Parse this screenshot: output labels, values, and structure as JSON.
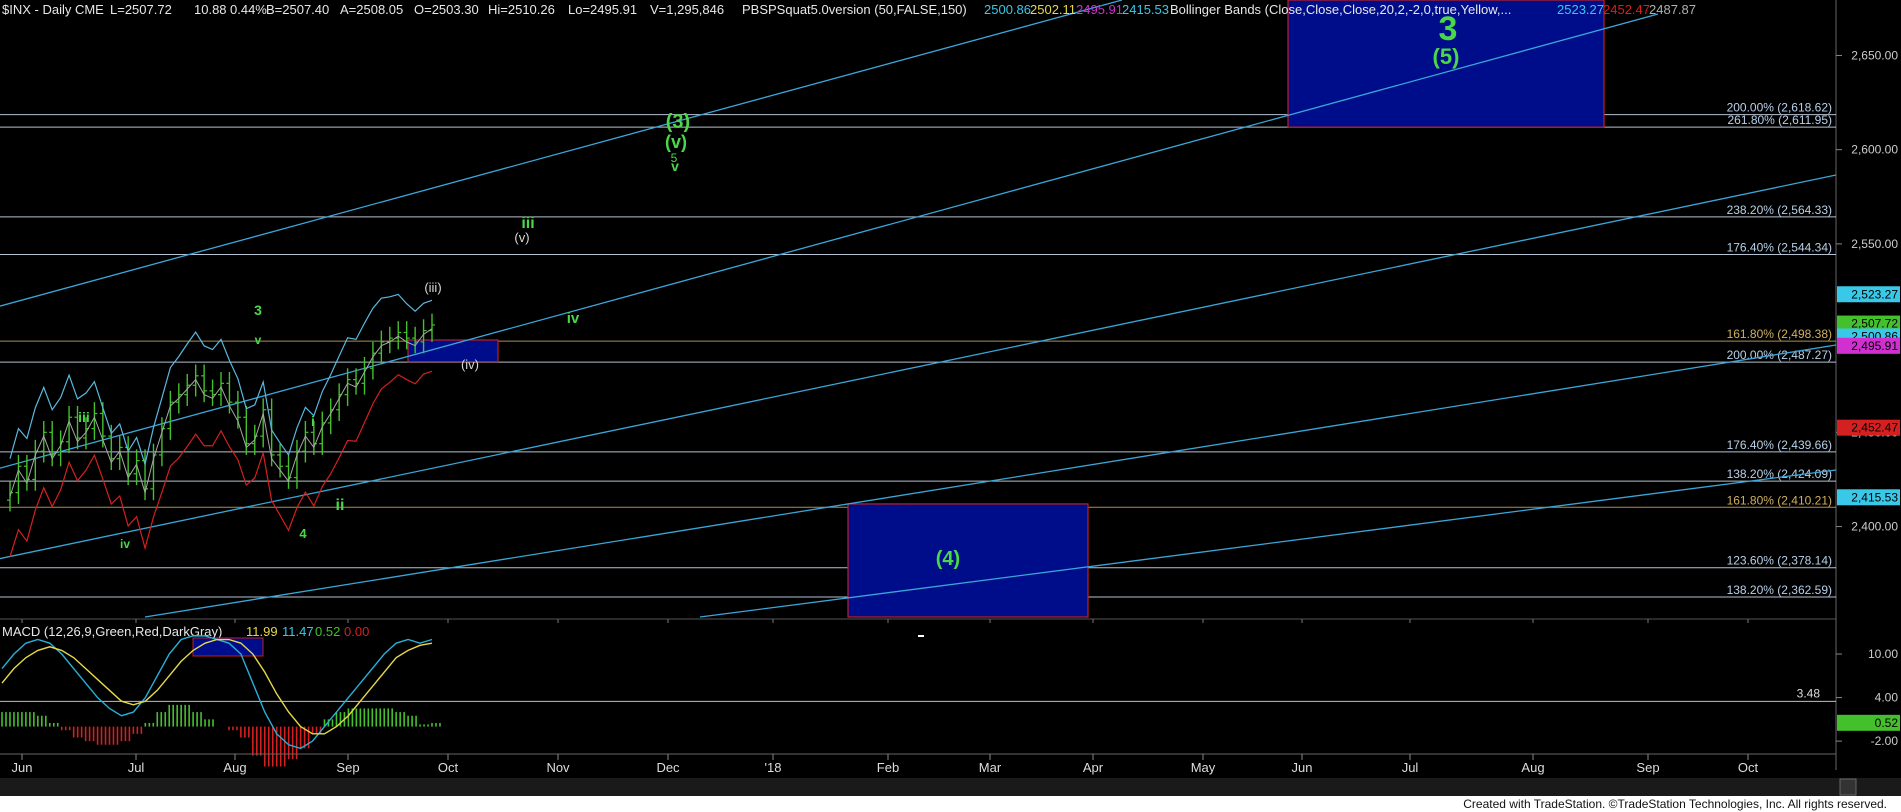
{
  "header": {
    "symbol": "$INX - Daily CME",
    "last": "L=2507.72",
    "chg": "10.88",
    "pct": "0.44%",
    "bid": "B=2507.40",
    "ask": "A=2508.05",
    "open": "O=2503.30",
    "hi": "Hi=2510.26",
    "lo": "Lo=2495.91",
    "vol": "V=1,295,846",
    "study": "PBSPSquat5.0version (50,FALSE,150)",
    "s1": "2500.86",
    "s2": "2502.11",
    "s3": "2495.91",
    "s4": "2415.53",
    "bb": "Bollinger Bands (Close,Close,Close,20,2,-2,0,true,Yellow,...",
    "b1": "2523.27",
    "b2": "2452.47",
    "b3": "2487.87"
  },
  "colors": {
    "background": "#000000",
    "grid": "#2a2a2a",
    "price_bar": "#44c02c",
    "channel": "#3aa6d8",
    "fib_line": "#c8d8e8",
    "fib_gold": "#b8a060",
    "box_fill": "#000d8a",
    "box_border": "#c02020",
    "wave_green": "#4ad84a",
    "macd_line": "#28b0d8",
    "macd_signal": "#e6d84a",
    "bb_upper": "#5ab8e0",
    "bb_lower": "#d42020",
    "bb_mid": "#a8a8a8"
  },
  "chart_data": [
    {
      "type": "candlestick",
      "title": "$INX - Daily CME",
      "ylim": [
        2352,
        2672
      ],
      "yticks": [
        "2,650.00",
        "2,600.00",
        "2,550.00",
        "2,450.00",
        "2,400.00"
      ],
      "x_labels": [
        "Jun",
        "Jul",
        "Aug",
        "Sep",
        "Oct",
        "Nov",
        "Dec",
        "'18",
        "Feb",
        "Mar",
        "Apr",
        "May",
        "Jun",
        "Jul",
        "Aug",
        "Sep",
        "Oct"
      ],
      "price_bars": [
        2418,
        2432,
        2425,
        2440,
        2450,
        2438,
        2445,
        2458,
        2447,
        2452,
        2460,
        2448,
        2436,
        2442,
        2428,
        2435,
        2420,
        2438,
        2452,
        2466,
        2470,
        2475,
        2480,
        2472,
        2470,
        2476,
        2466,
        2458,
        2444,
        2448,
        2462,
        2438,
        2432,
        2426,
        2440,
        2450,
        2444,
        2455,
        2462,
        2470,
        2478,
        2476,
        2484,
        2492,
        2498,
        2500,
        2503,
        2500,
        2498,
        2504,
        2507
      ],
      "price_right_labels": [
        {
          "value": 2523.27,
          "text": "2,523.27",
          "bg": "#3ac8e8"
        },
        {
          "value": 2507.72,
          "text": "2,507.72",
          "bg": "#44c02c"
        },
        {
          "value": 2500.86,
          "text": "2,500.86",
          "bg": "#3ac8e8"
        },
        {
          "value": 2495.91,
          "text": "2,495.91",
          "bg": "#d030d0"
        },
        {
          "value": 2452.47,
          "text": "2,452.47",
          "bg": "#d42020"
        },
        {
          "value": 2415.53,
          "text": "2,415.53",
          "bg": "#3ac8e8"
        }
      ],
      "fib_levels": [
        {
          "value": 2618.62,
          "label": "200.00% (2,618.62)"
        },
        {
          "value": 2611.95,
          "label": "261.80% (2,611.95)"
        },
        {
          "value": 2564.33,
          "label": "238.20% (2,564.33)"
        },
        {
          "value": 2544.34,
          "label": "176.40% (2,544.34)"
        },
        {
          "value": 2498.38,
          "label": "161.80% (2,498.38)",
          "gold": true
        },
        {
          "value": 2487.27,
          "label": "200.00% (2,487.27)"
        },
        {
          "value": 2439.66,
          "label": "176.40% (2,439.66)"
        },
        {
          "value": 2424.09,
          "label": "138.20% (2,424.09)"
        },
        {
          "value": 2410.21,
          "label": "161.80% (2,410.21)",
          "gold": true
        },
        {
          "value": 2378.14,
          "label": "123.60% (2,378.14)"
        },
        {
          "value": 2362.59,
          "label": "138.20% (2,362.59)"
        }
      ],
      "wave_labels": [
        {
          "text": "3",
          "big": true
        },
        {
          "text": "(5)"
        },
        {
          "text": "(3)"
        },
        {
          "text": "(v)"
        },
        {
          "text": "5"
        },
        {
          "text": "v"
        },
        {
          "text": "iii"
        },
        {
          "text": "(v)"
        },
        {
          "text": "(iii)"
        },
        {
          "text": "iv"
        },
        {
          "text": "3"
        },
        {
          "text": "v"
        },
        {
          "text": "(iv)"
        },
        {
          "text": "iii"
        },
        {
          "text": "i"
        },
        {
          "text": "ii"
        },
        {
          "text": "4"
        },
        {
          "text": "iv"
        },
        {
          "text": "(4)"
        }
      ]
    },
    {
      "type": "line",
      "title": "MACD (12,26,9,Green,Red,DarkGray)",
      "legend_values": [
        "11.99",
        "11.47",
        "0.52",
        "0.00"
      ],
      "ylim": [
        -3.5,
        14
      ],
      "yticks": [
        "10.00",
        "4.00",
        "-2.00"
      ],
      "level_line": {
        "value": 3.48,
        "text": "3.48"
      },
      "right_label": {
        "value": 0.52,
        "text": "0.52"
      },
      "series": [
        {
          "name": "MACD",
          "values": [
            8,
            10,
            11.5,
            12,
            11.5,
            10,
            8,
            6,
            4,
            2.5,
            1.5,
            2,
            4,
            7,
            10,
            12,
            12.5,
            12.5,
            12,
            11.5,
            10,
            6,
            2,
            -1,
            -2.5,
            -3,
            -2,
            0,
            2,
            4,
            6,
            8,
            10,
            11.5,
            12,
            11.5,
            12
          ]
        },
        {
          "name": "Avg",
          "values": [
            6,
            8,
            9.5,
            10.5,
            11,
            10.5,
            9.5,
            8,
            6.5,
            5,
            3.5,
            3,
            3.5,
            5,
            7,
            9,
            10.5,
            11.5,
            12,
            12,
            11.5,
            10,
            7.5,
            4.5,
            2,
            0,
            -1,
            -1,
            0,
            1.5,
            3.5,
            5.5,
            7.5,
            9.5,
            10.5,
            11.2,
            11.5
          ]
        },
        {
          "name": "Diff",
          "values": [
            2,
            2,
            2,
            1.5,
            0.5,
            -0.5,
            -1.5,
            -2,
            -2.5,
            -2.5,
            -2,
            -1,
            0.5,
            2,
            3,
            3,
            2,
            1,
            0,
            -0.5,
            -1.5,
            -4,
            -5.5,
            -5.5,
            -4.5,
            -3,
            -1,
            1,
            2,
            2.5,
            2.5,
            2.5,
            2.5,
            2,
            1.5,
            0.3,
            0.5
          ]
        }
      ]
    }
  ],
  "footer_text": "Created with TradeStation. ©TradeStation Technologies, Inc. All rights reserved."
}
